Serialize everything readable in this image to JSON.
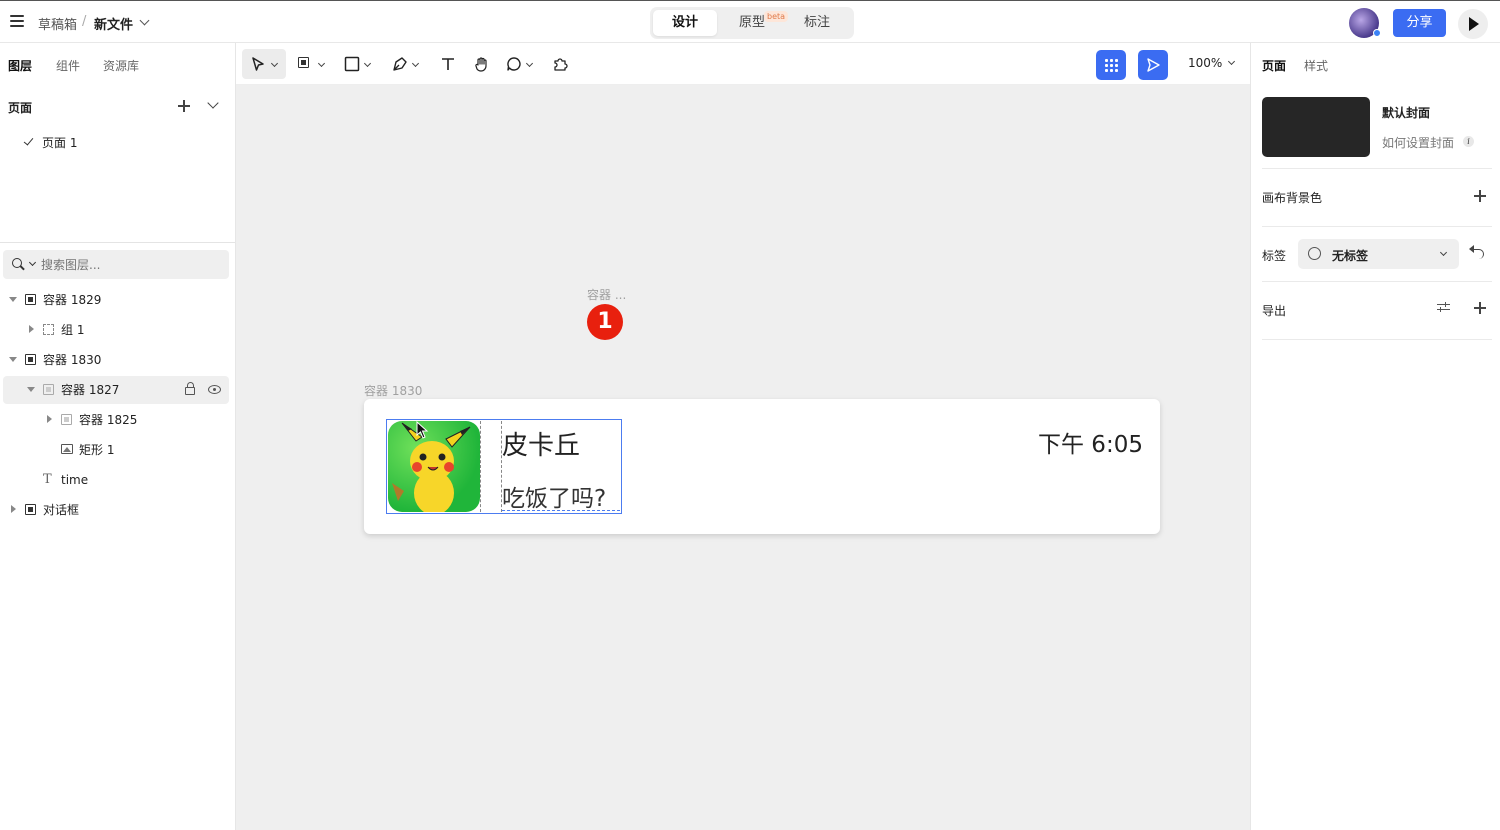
{
  "topbar": {
    "breadcrumb_root": "草稿箱",
    "breadcrumb_sep": "/",
    "file_name": "新文件",
    "modes": [
      {
        "label": "设计",
        "active": true
      },
      {
        "label": "原型",
        "active": false
      },
      {
        "label": "标注",
        "active": false
      }
    ],
    "beta_badge": "beta",
    "share_label": "分享"
  },
  "left_panel": {
    "tabs": [
      "图层",
      "组件",
      "资源库"
    ],
    "pages_header": "页面",
    "pages": [
      "页面 1"
    ],
    "search_placeholder": "搜索图层...",
    "layers": [
      {
        "label": "容器 1829",
        "depth": 0,
        "expanded": true,
        "icon": "frame-icon"
      },
      {
        "label": "组 1",
        "depth": 1,
        "expanded": false,
        "icon": "group-icon"
      },
      {
        "label": "容器 1830",
        "depth": 0,
        "expanded": true,
        "icon": "frame-icon"
      },
      {
        "label": "容器 1827",
        "depth": 1,
        "expanded": true,
        "icon": "frame-icon",
        "selected": true
      },
      {
        "label": "容器 1825",
        "depth": 2,
        "expanded": false,
        "icon": "frame-icon"
      },
      {
        "label": "矩形 1",
        "depth": 2,
        "icon": "image-icon"
      },
      {
        "label": "time",
        "depth": 1,
        "icon": "text-icon"
      },
      {
        "label": "对话框",
        "depth": 0,
        "expanded": false,
        "icon": "frame-icon"
      }
    ]
  },
  "toolbar": {
    "zoom": "100%",
    "accent": "#3b6cf2"
  },
  "canvas": {
    "frame_label_top": "容器 ...",
    "badge_number": "1",
    "frame_label_card": "容器 1830",
    "card": {
      "name": "皮卡丘",
      "message": "吃饭了吗?",
      "time": "下午 6:05"
    }
  },
  "right_panel": {
    "tabs": [
      "页面",
      "样式"
    ],
    "cover_title": "默认封面",
    "cover_link": "如何设置封面",
    "canvas_bg_label": "画布背景色",
    "tag_label": "标签",
    "tag_value": "无标签",
    "export_label": "导出"
  },
  "help_label": "?"
}
